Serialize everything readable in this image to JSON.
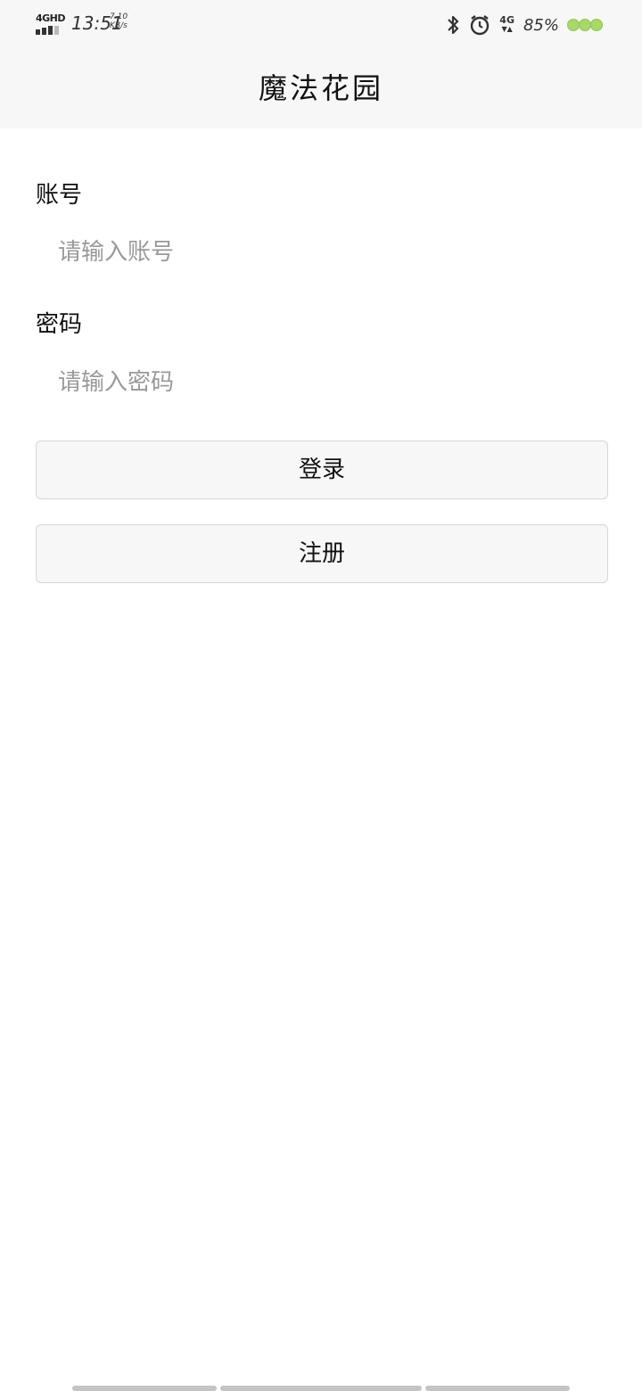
{
  "status_bar": {
    "network_type": "4GHD",
    "time": "13:51",
    "speed_value": "7.10",
    "speed_unit": "KB/s",
    "data_type": "4G",
    "battery_percent": "85%",
    "icons": [
      "bluetooth-icon",
      "alarm-icon"
    ],
    "battery_color": "#a8d86a"
  },
  "header": {
    "title": "魔法花园"
  },
  "form": {
    "account_label": "账号",
    "account_placeholder": "请输入账号",
    "account_value": "",
    "password_label": "密码",
    "password_placeholder": "请输入密码",
    "password_value": ""
  },
  "actions": {
    "login_label": "登录",
    "register_label": "注册"
  }
}
